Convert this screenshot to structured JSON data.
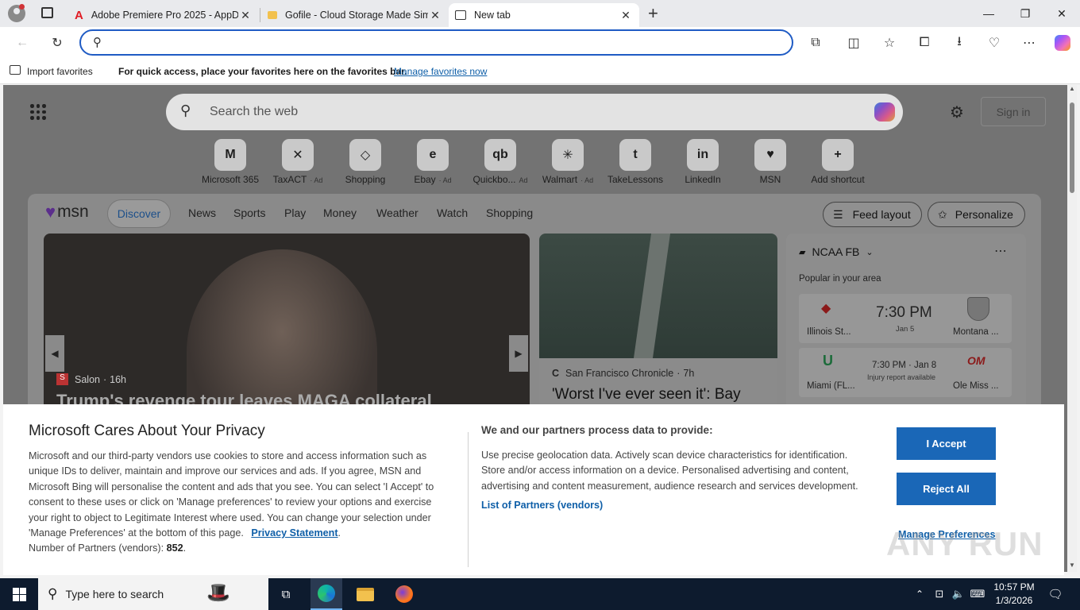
{
  "tabs": [
    {
      "title": "Adobe Premiere Pro 2025 - AppD",
      "icon": "adobe-icon"
    },
    {
      "title": "Gofile - Cloud Storage Made Simp",
      "icon": "folder-icon"
    },
    {
      "title": "New tab",
      "icon": "newtab-icon"
    }
  ],
  "favorites": {
    "import": "Import favorites",
    "message": "For quick access, place your favorites here on the favorites bar.",
    "manage": "Manage favorites now"
  },
  "ntp": {
    "search_placeholder": "Search the web",
    "signin": "Sign in",
    "shortcuts": [
      {
        "label": "Microsoft 365",
        "ad": "",
        "glyph": "M"
      },
      {
        "label": "TaxACT",
        "ad": "· Ad",
        "glyph": "✕"
      },
      {
        "label": "Shopping",
        "ad": "",
        "glyph": "◇"
      },
      {
        "label": "Ebay",
        "ad": "· Ad",
        "glyph": "e"
      },
      {
        "label": "Quickbo...",
        "ad": "Ad",
        "glyph": "qb"
      },
      {
        "label": "Walmart",
        "ad": "· Ad",
        "glyph": "✳"
      },
      {
        "label": "TakeLessons",
        "ad": "",
        "glyph": "t"
      },
      {
        "label": "LinkedIn",
        "ad": "",
        "glyph": "in"
      },
      {
        "label": "MSN",
        "ad": "",
        "glyph": "♥"
      },
      {
        "label": "Add shortcut",
        "ad": "",
        "glyph": "+"
      }
    ]
  },
  "feed": {
    "logo": "msn",
    "nav": [
      "Discover",
      "News",
      "Sports",
      "Play",
      "Money",
      "Weather",
      "Watch",
      "Shopping"
    ],
    "feed_layout": "Feed layout",
    "personalize": "Personalize",
    "card1": {
      "source": "Salon",
      "time": "16h",
      "headline": "Trump's revenge tour leaves MAGA collateral"
    },
    "card2": {
      "source": "San Francisco Chronicle",
      "time": "7h",
      "headline": "'Worst I've ever seen it': Bay"
    },
    "sports": {
      "league": "NCAA FB",
      "subtitle": "Popular in your area",
      "games": [
        {
          "team1": "Illinois St...",
          "team2": "Montana ...",
          "time": "7:30 PM",
          "date": "Jan 5",
          "note": ""
        },
        {
          "team1": "Miami (FL...",
          "team2": "Ole Miss ...",
          "time": "7:30 PM · Jan 8",
          "date": "",
          "note": "Injury report available"
        }
      ]
    }
  },
  "cookie": {
    "title": "Microsoft Cares About Your Privacy",
    "body": "Microsoft and our third-party vendors use cookies to store and access information such as unique IDs to deliver, maintain and improve our services and ads. If you agree, MSN and Microsoft Bing will personalise the content and ads that you see. You can select 'I Accept' to consent to these uses or click on 'Manage preferences' to review your options and exercise your right to object to Legitimate Interest where used.  You can change your selection under 'Manage Preferences' at the bottom of this page.",
    "privacy_link": "Privacy Statement",
    "partners_label": "Number of Partners (vendors):",
    "partners_count": "852",
    "provide_title": "We and our partners process data to provide:",
    "provide_body": "Use precise geolocation data. Actively scan device characteristics for identification. Store and/or access information on a device. Personalised advertising and content, advertising and content measurement, audience research and services development.",
    "partners_link": "List of Partners (vendors)",
    "accept": "I Accept",
    "reject": "Reject All",
    "manage": "Manage Preferences"
  },
  "watermark": "ANY RUN",
  "taskbar": {
    "search": "Type here to search",
    "time": "10:57 PM",
    "date": "1/3/2026"
  },
  "colors": {
    "accent": "#1a67b7",
    "address_border": "#1f5bc4",
    "taskbar": "#0d1b2e",
    "link": "#0f5fa8"
  }
}
